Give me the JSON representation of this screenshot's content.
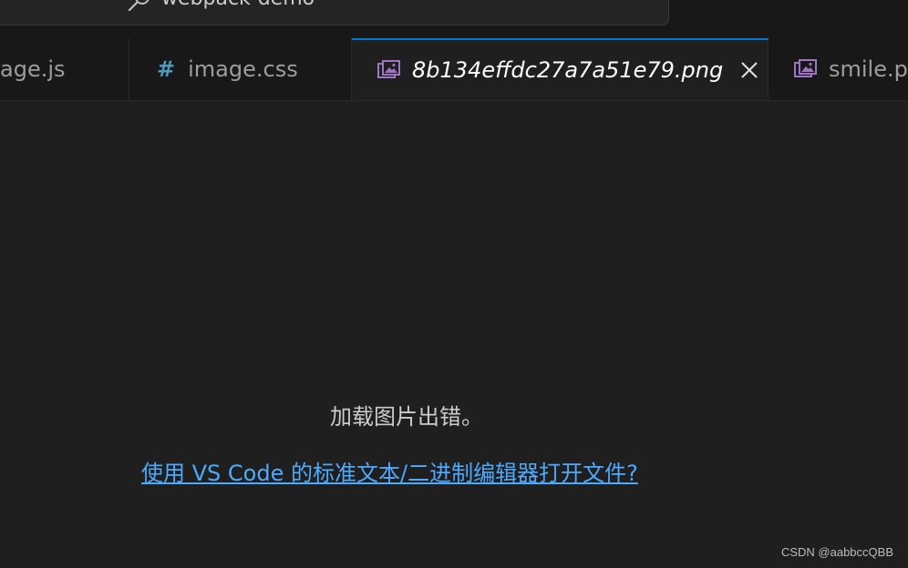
{
  "command_center": {
    "title": "webpack-demo",
    "search_icon": "search-icon"
  },
  "tabs": [
    {
      "label": "age.js",
      "icon": "js-file-icon",
      "active": false
    },
    {
      "label": "image.css",
      "icon": "hash-icon",
      "icon_glyph": "#",
      "active": false
    },
    {
      "label": "8b134effdc27a7a51e79.png",
      "icon": "image-file-icon",
      "active": true,
      "close_icon": "close-icon"
    },
    {
      "label": "smile.p",
      "icon": "image-file-icon",
      "active": false
    }
  ],
  "editor": {
    "error_message": "加载图片出错。",
    "open_link": "使用 VS Code 的标准文本/二进制编辑器打开文件?"
  },
  "watermark": "CSDN @aabbccQBB",
  "colors": {
    "accent": "#0078d4",
    "link": "#4daafc",
    "css_icon": "#519aba",
    "image_icon": "#a074c4",
    "editor_bg": "#1f1f1f",
    "tabbar_bg": "#181818"
  }
}
